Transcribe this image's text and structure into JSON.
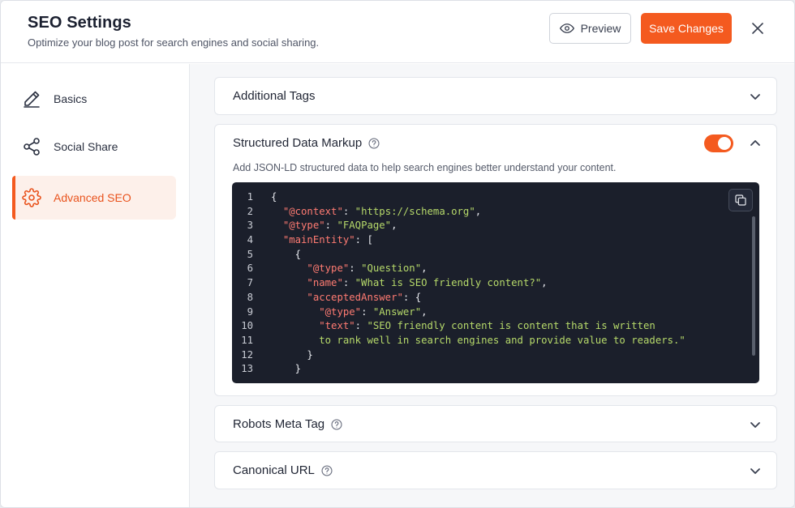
{
  "header": {
    "title": "SEO Settings",
    "subtitle": "Optimize your blog post for search engines and social sharing.",
    "preview_label": "Preview",
    "save_label": "Save Changes"
  },
  "sidebar": {
    "items": [
      {
        "label": "Basics",
        "icon": "pencil-icon",
        "active": false
      },
      {
        "label": "Social Share",
        "icon": "share-icon",
        "active": false
      },
      {
        "label": "Advanced SEO",
        "icon": "gear-icon",
        "active": true
      }
    ]
  },
  "panels": {
    "additional_tags": {
      "title": "Additional Tags",
      "expanded": false
    },
    "structured_data": {
      "title": "Structured Data Markup",
      "description": "Add JSON-LD structured data to help search engines better understand your content.",
      "enabled": true,
      "expanded": true,
      "code_lines": [
        [
          {
            "t": "p",
            "v": "{"
          }
        ],
        [
          {
            "t": "p",
            "v": "  "
          },
          {
            "t": "k",
            "v": "\"@context\""
          },
          {
            "t": "p",
            "v": ": "
          },
          {
            "t": "s",
            "v": "\"https://schema.org\""
          },
          {
            "t": "p",
            "v": ","
          }
        ],
        [
          {
            "t": "p",
            "v": "  "
          },
          {
            "t": "k",
            "v": "\"@type\""
          },
          {
            "t": "p",
            "v": ": "
          },
          {
            "t": "s",
            "v": "\"FAQPage\""
          },
          {
            "t": "p",
            "v": ","
          }
        ],
        [
          {
            "t": "p",
            "v": "  "
          },
          {
            "t": "k",
            "v": "\"mainEntity\""
          },
          {
            "t": "p",
            "v": ": ["
          }
        ],
        [
          {
            "t": "p",
            "v": "    {"
          }
        ],
        [
          {
            "t": "p",
            "v": "      "
          },
          {
            "t": "k",
            "v": "\"@type\""
          },
          {
            "t": "p",
            "v": ": "
          },
          {
            "t": "s",
            "v": "\"Question\""
          },
          {
            "t": "p",
            "v": ","
          }
        ],
        [
          {
            "t": "p",
            "v": "      "
          },
          {
            "t": "k",
            "v": "\"name\""
          },
          {
            "t": "p",
            "v": ": "
          },
          {
            "t": "s",
            "v": "\"What is SEO friendly content?\""
          },
          {
            "t": "p",
            "v": ","
          }
        ],
        [
          {
            "t": "p",
            "v": "      "
          },
          {
            "t": "k",
            "v": "\"acceptedAnswer\""
          },
          {
            "t": "p",
            "v": ": {"
          }
        ],
        [
          {
            "t": "p",
            "v": "        "
          },
          {
            "t": "k",
            "v": "\"@type\""
          },
          {
            "t": "p",
            "v": ": "
          },
          {
            "t": "s",
            "v": "\"Answer\""
          },
          {
            "t": "p",
            "v": ","
          }
        ],
        [
          {
            "t": "p",
            "v": "        "
          },
          {
            "t": "k",
            "v": "\"text\""
          },
          {
            "t": "p",
            "v": ": "
          },
          {
            "t": "s",
            "v": "\"SEO friendly content is content that is written"
          }
        ],
        [
          {
            "t": "s",
            "v": "        to rank well in search engines and provide value to readers.\""
          }
        ],
        [
          {
            "t": "p",
            "v": "      }"
          }
        ],
        [
          {
            "t": "p",
            "v": "    }"
          }
        ]
      ]
    },
    "robots": {
      "title": "Robots Meta Tag",
      "expanded": false
    },
    "canonical": {
      "title": "Canonical URL",
      "expanded": false
    }
  },
  "colors": {
    "accent": "#f45a1f",
    "code_bg": "#1b1f2b",
    "code_key": "#ff7b72",
    "code_string": "#b6d96a"
  }
}
